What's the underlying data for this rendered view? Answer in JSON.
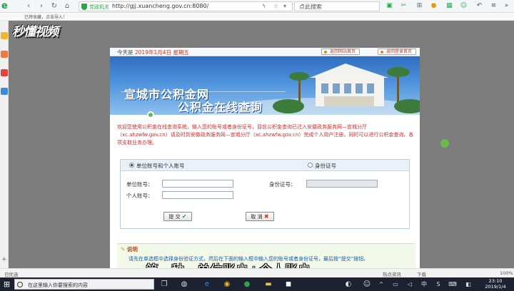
{
  "browser": {
    "site_label": "党政机关",
    "url": "http://gjj.xuancheng.gov.cn:8080/",
    "search_placeholder": "点此搜索",
    "bookmark_hint": "已将收藏，点击导入！"
  },
  "watermark": "秒懂视频",
  "page": {
    "date_prefix": "今天是",
    "date_value": "2019年1月4日 星期五",
    "link_home": "返回网站首页",
    "link_login": "返回登录首页",
    "banner_title1": "宣城市公积金网",
    "banner_title2": "公积金在线查询",
    "notice": "欢迎您使用公积金在线查询系统，输入您的账号或者身份证号，目前公积金查询已迁入安徽政务服务网—宣城分厅（xc.ahzwfw.gov.cn）请及时到安徽政务服务网—宣城分厅（xc.ahzwfw.gov.cn）完成个人用户注册，同时可以进行公积金查询、各项支取业务办理。",
    "radio_unit": "单位账号和个人账号",
    "radio_id": "身份证号",
    "label_unit_account": "单位账号：",
    "label_personal_account": "个人账号：",
    "label_id_number": "身份证号：",
    "submit_label": "提 交",
    "cancel_label": "取 消",
    "note_heading": "说明",
    "note_body": "请先在单选框中选择身份验证方式，然后在下面的输入框中输入您的账号或者身份证号，最后按“提交”按钮。"
  },
  "subtitle": "第一种，单位账户+个人账户",
  "status": {
    "left": "日优选",
    "items": [
      "热点资讯",
      "下载",
      "100%"
    ]
  },
  "taskbar": {
    "search_placeholder": "在这里输入你要搜索的内容",
    "time": "23:10",
    "date": "2019/1/4"
  }
}
